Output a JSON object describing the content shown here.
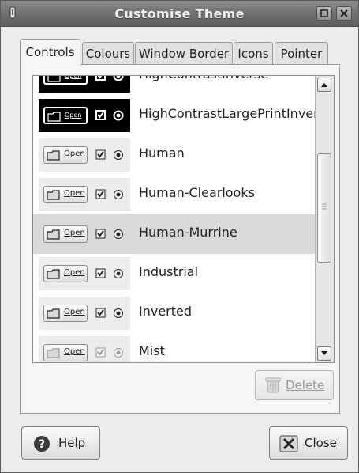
{
  "window": {
    "title": "Customise Theme",
    "icon": "app-icon",
    "buttons": [
      "maximize-icon",
      "close-icon"
    ]
  },
  "tabs": [
    {
      "label": "Controls",
      "active": true
    },
    {
      "label": "Colours",
      "active": false
    },
    {
      "label": "Window Border",
      "active": false
    },
    {
      "label": "Icons",
      "active": false
    },
    {
      "label": "Pointer",
      "active": false
    }
  ],
  "themes": [
    {
      "name": "HighContrastInverse",
      "preview_label": "Open",
      "style": "dark",
      "selected": false
    },
    {
      "name": "HighContrastLargePrintInvers",
      "preview_label": "Open",
      "style": "dark",
      "selected": false
    },
    {
      "name": "Human",
      "preview_label": "Open",
      "style": "light",
      "selected": false
    },
    {
      "name": "Human-Clearlooks",
      "preview_label": "Open",
      "style": "light",
      "selected": false
    },
    {
      "name": "Human-Murrine",
      "preview_label": "Open",
      "style": "light",
      "selected": true
    },
    {
      "name": "Industrial",
      "preview_label": "Open",
      "style": "light",
      "selected": false
    },
    {
      "name": "Inverted",
      "preview_label": "Open",
      "style": "light",
      "selected": false
    },
    {
      "name": "Mist",
      "preview_label": "Open",
      "style": "faint",
      "selected": false
    }
  ],
  "scroll": {
    "position_fraction": 0.42
  },
  "buttons": {
    "delete": "Delete",
    "help": "Help",
    "close": "Close"
  },
  "colors": {
    "titlebar": "#6e6e6e",
    "selected_row": "#d9d9d9",
    "dialog_bg": "#ececec"
  }
}
